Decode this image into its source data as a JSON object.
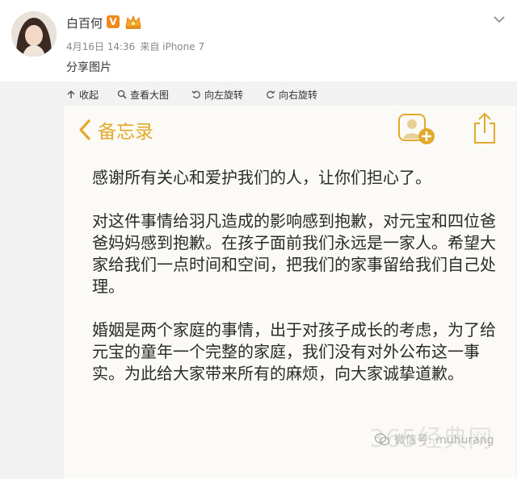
{
  "post": {
    "username": "白百何",
    "verified_badge": "V",
    "timestamp": "4月16日 14:36",
    "source": "来自 iPhone 7",
    "text": "分享图片"
  },
  "toolbar": {
    "collapse_label": "收起",
    "view_large_label": "查看大图",
    "rotate_left_label": "向左旋转",
    "rotate_right_label": "向右旋转"
  },
  "notes": {
    "back_label": "备忘录",
    "accent_color": "#e2aa2a",
    "paragraphs": [
      "感谢所有关心和爱护我们的人，让你们担心了。",
      "对这件事情给羽凡造成的影响感到抱歉，对元宝和四位爸爸妈妈感到抱歉。在孩子面前我们永远是一家人。希望大家给我们一点时间和空间，把我们的家事留给我们自己处理。",
      "婚姻是两个家庭的事情，出于对孩子成长的考虑，为了给元宝的童年一个完整的家庭，我们没有对外公布这一事实。为此给大家带来所有的麻烦，向大家诚挚道歉。"
    ]
  },
  "watermark": {
    "site": "365经典网",
    "wechat": "微信号: muhurang"
  },
  "icons": {
    "more": "chevron-down-icon",
    "crown": "crown-badge-icon",
    "add_person": "add-person-icon",
    "share": "share-icon"
  }
}
